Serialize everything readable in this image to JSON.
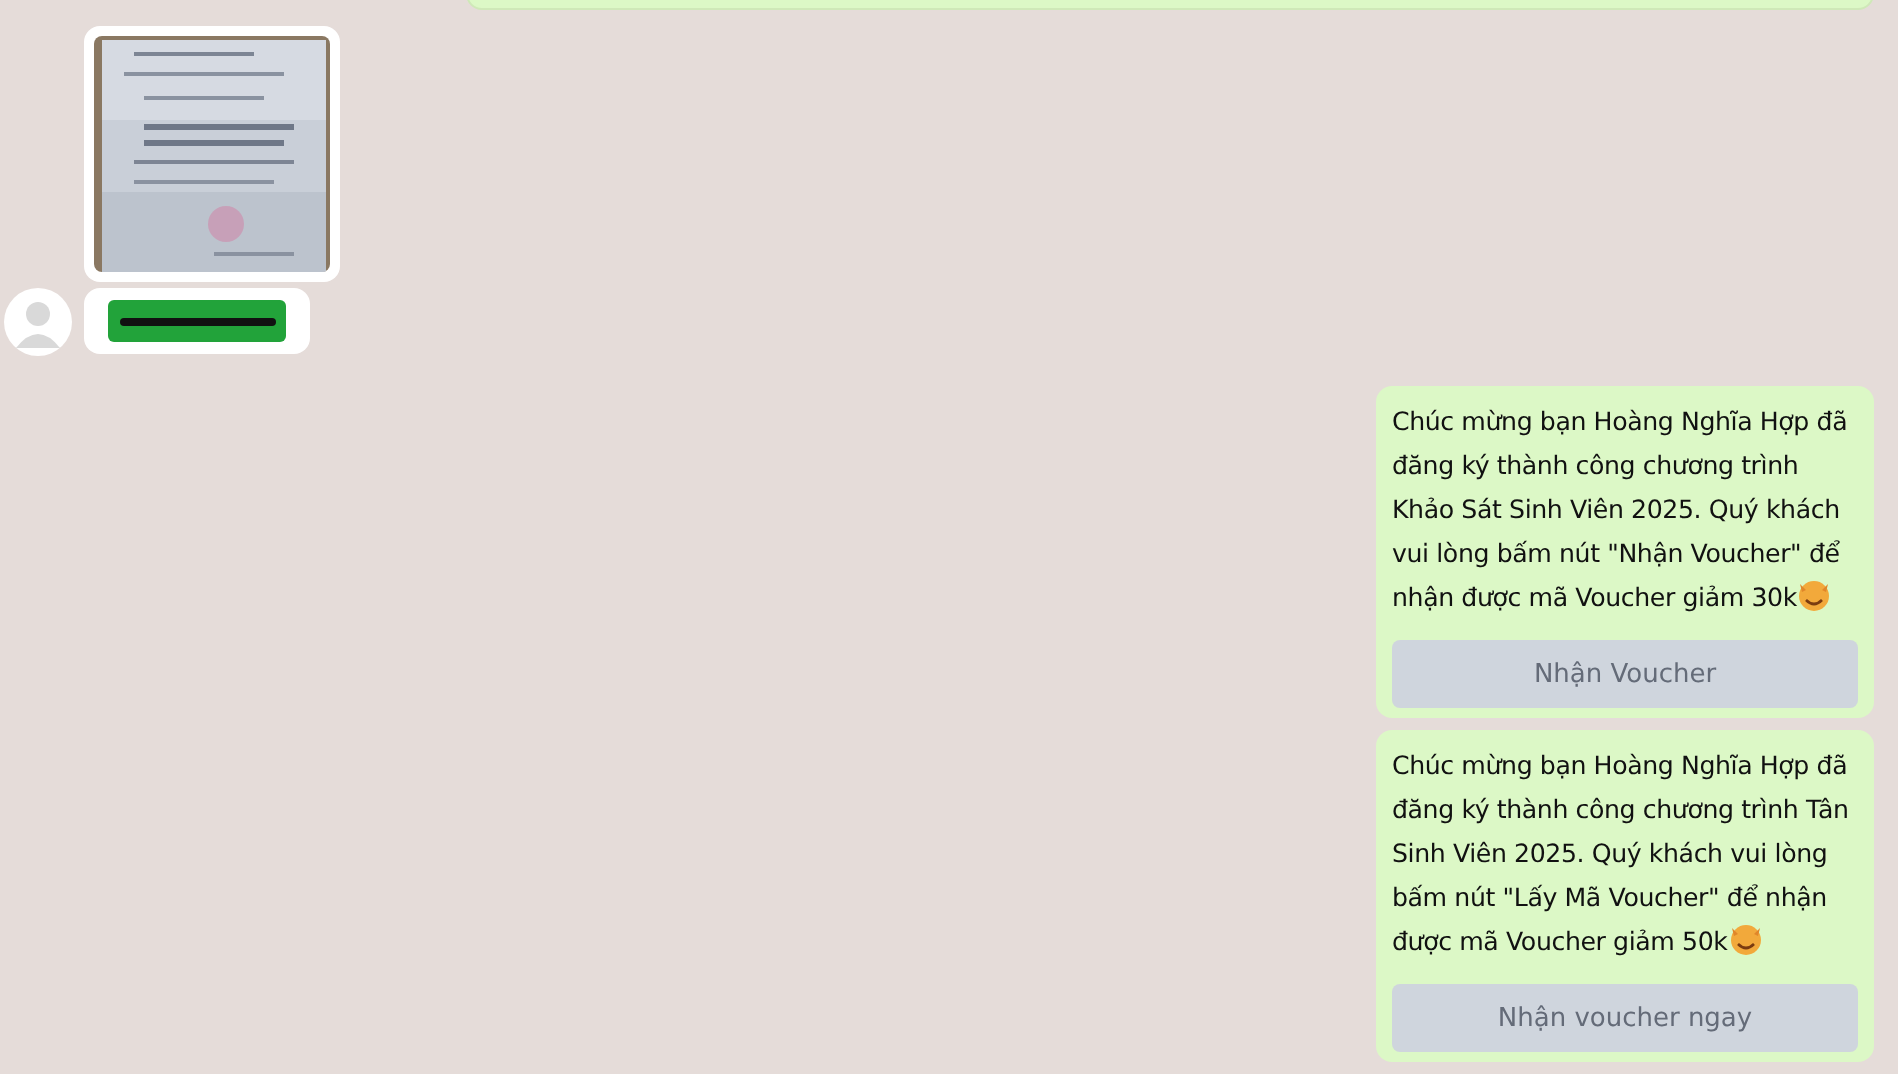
{
  "incoming": [
    {
      "kind": "picture"
    },
    {
      "kind": "redacted"
    }
  ],
  "outgoing": [
    {
      "kind": "text",
      "text": "Chúc mừng bạn Hoàng Nghĩa Hợp đã đăng ký thành công chương trình Khảo Sát Sinh Viên 2025. Quý khách vui lòng bấm nút \"Nhận Voucher\" để nhận được mã Voucher giảm 30k",
      "button": "Nhận Voucher"
    },
    {
      "kind": "text",
      "text": "Chúc mừng bạn Hoàng Nghĩa Hợp đã đăng ký thành công chương trình Tân Sinh Viên 2025. Quý khách vui lòng bấm nút \"Lấy Mã Voucher\" để nhận được mã Voucher giảm 50k",
      "button": "Nhận voucher ngay"
    }
  ]
}
